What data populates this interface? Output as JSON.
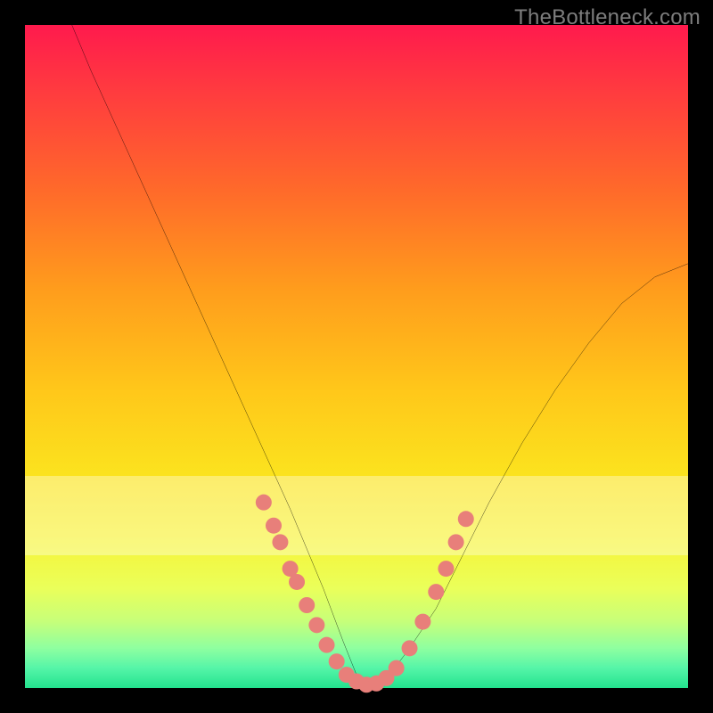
{
  "watermark": "TheBottleneck.com",
  "chart_data": {
    "type": "line",
    "title": "",
    "xlabel": "",
    "ylabel": "",
    "xlim": [
      0,
      100
    ],
    "ylim": [
      0,
      100
    ],
    "series": [
      {
        "name": "bottleneck-curve",
        "x": [
          0,
          5,
          10,
          15,
          20,
          25,
          30,
          35,
          40,
          45,
          48,
          50,
          52,
          55,
          58,
          62,
          66,
          70,
          75,
          80,
          85,
          90,
          95,
          100
        ],
        "values": [
          115,
          105,
          93,
          82,
          71,
          60,
          49,
          38,
          27,
          15,
          7,
          2,
          0,
          2,
          6,
          12,
          20,
          28,
          37,
          45,
          52,
          58,
          62,
          64
        ]
      }
    ],
    "markers": [
      {
        "x": 36.0,
        "y": 28.0
      },
      {
        "x": 37.5,
        "y": 24.5
      },
      {
        "x": 38.5,
        "y": 22.0
      },
      {
        "x": 40.0,
        "y": 18.0
      },
      {
        "x": 41.0,
        "y": 16.0
      },
      {
        "x": 42.5,
        "y": 12.5
      },
      {
        "x": 44.0,
        "y": 9.5
      },
      {
        "x": 45.5,
        "y": 6.5
      },
      {
        "x": 47.0,
        "y": 4.0
      },
      {
        "x": 48.5,
        "y": 2.0
      },
      {
        "x": 50.0,
        "y": 1.0
      },
      {
        "x": 51.5,
        "y": 0.5
      },
      {
        "x": 53.0,
        "y": 0.7
      },
      {
        "x": 54.5,
        "y": 1.5
      },
      {
        "x": 56.0,
        "y": 3.0
      },
      {
        "x": 58.0,
        "y": 6.0
      },
      {
        "x": 60.0,
        "y": 10.0
      },
      {
        "x": 62.0,
        "y": 14.5
      },
      {
        "x": 63.5,
        "y": 18.0
      },
      {
        "x": 65.0,
        "y": 22.0
      },
      {
        "x": 66.5,
        "y": 25.5
      }
    ],
    "bands": [
      {
        "y0": 68,
        "y1": 80,
        "alpha": 0.35
      }
    ],
    "marker_style": {
      "color": "#e87f7a",
      "radius": 9
    },
    "curve_style": {
      "color": "#000000",
      "width": 2
    }
  }
}
